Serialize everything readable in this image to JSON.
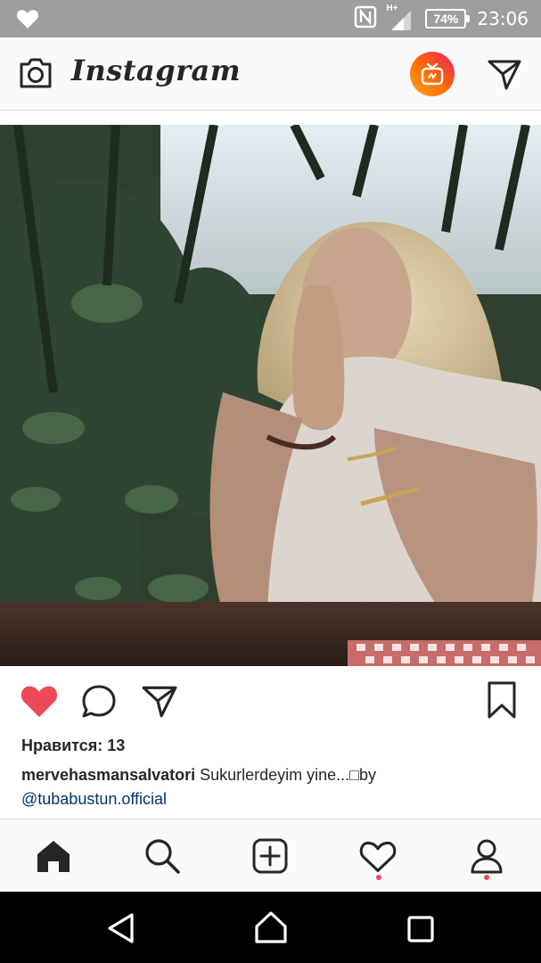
{
  "status_bar": {
    "network_type": "H+",
    "battery_percent": "74%",
    "time": "23:06"
  },
  "header": {
    "app_name": "Instagram"
  },
  "post": {
    "likes_text": "Нравится: 13",
    "caption_user": "mervehasmansalvatori",
    "caption_text": " Sukurlerdeyim yine...□by",
    "caption_mention": "@tubabustun.official",
    "liked": true,
    "like_color": "#ed4956"
  },
  "bottom_nav": {
    "items": [
      "home-icon",
      "search-icon",
      "add-post-icon",
      "activity-heart-icon",
      "profile-icon"
    ],
    "notification_dot_color": "#ed4956"
  }
}
